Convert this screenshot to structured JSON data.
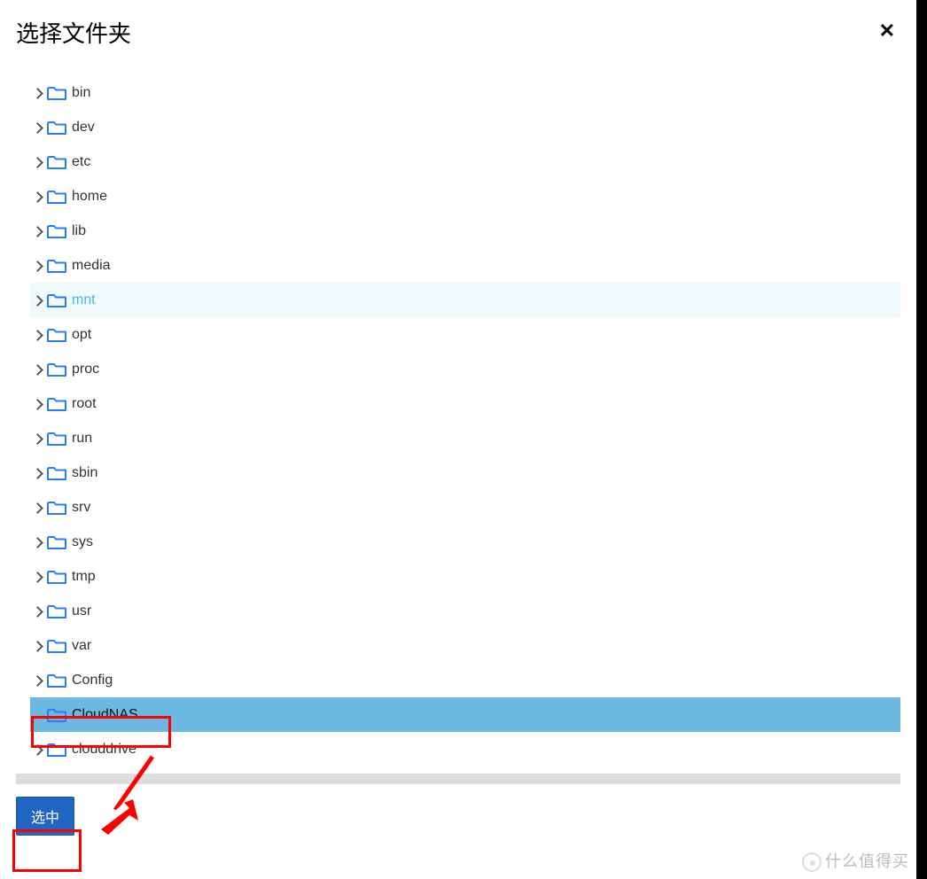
{
  "modal": {
    "title": "选择文件夹",
    "close_symbol": "✕"
  },
  "tree": [
    {
      "label": "bin",
      "state": "normal",
      "hasChevron": true
    },
    {
      "label": "dev",
      "state": "normal",
      "hasChevron": true
    },
    {
      "label": "etc",
      "state": "normal",
      "hasChevron": true
    },
    {
      "label": "home",
      "state": "normal",
      "hasChevron": true
    },
    {
      "label": "lib",
      "state": "normal",
      "hasChevron": true
    },
    {
      "label": "media",
      "state": "normal",
      "hasChevron": true
    },
    {
      "label": "mnt",
      "state": "active-light",
      "hasChevron": true
    },
    {
      "label": "opt",
      "state": "normal",
      "hasChevron": true
    },
    {
      "label": "proc",
      "state": "normal",
      "hasChevron": true
    },
    {
      "label": "root",
      "state": "normal",
      "hasChevron": true
    },
    {
      "label": "run",
      "state": "normal",
      "hasChevron": true
    },
    {
      "label": "sbin",
      "state": "normal",
      "hasChevron": true
    },
    {
      "label": "srv",
      "state": "normal",
      "hasChevron": true
    },
    {
      "label": "sys",
      "state": "normal",
      "hasChevron": true
    },
    {
      "label": "tmp",
      "state": "normal",
      "hasChevron": true
    },
    {
      "label": "usr",
      "state": "normal",
      "hasChevron": true
    },
    {
      "label": "var",
      "state": "normal",
      "hasChevron": true
    },
    {
      "label": "Config",
      "state": "normal",
      "hasChevron": true
    },
    {
      "label": "CloudNAS",
      "state": "selected",
      "hasChevron": false
    },
    {
      "label": "clouddrive",
      "state": "normal",
      "hasChevron": true
    }
  ],
  "footer": {
    "select_label": "选中"
  },
  "watermark": "什么值得买",
  "colors": {
    "folder_stroke": "#2a7cff",
    "highlight_bg": "#6cb8e0",
    "active_text": "#46b8da",
    "button_bg": "#2066c2",
    "annotation": "#f00"
  }
}
